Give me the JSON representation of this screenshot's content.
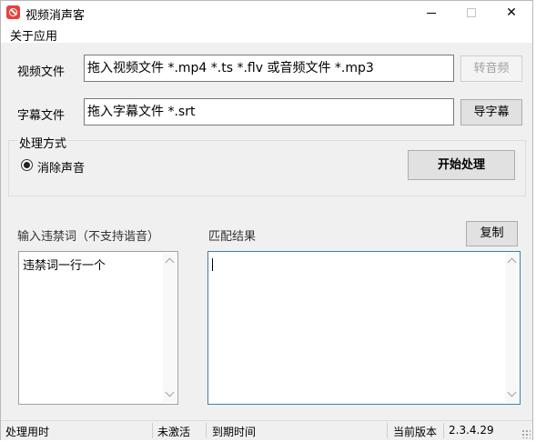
{
  "window": {
    "title": "视频消声客",
    "minimize_glyph": "—",
    "maximize_glyph": "☐",
    "close_glyph": "✕"
  },
  "menu": {
    "items": [
      "关于应用"
    ]
  },
  "video_row": {
    "label": "视频文件",
    "value": "拖入视频文件 *.mp4 *.ts *.flv 或音频文件 *.mp3",
    "button": "转音频"
  },
  "subtitle_row": {
    "label": "字幕文件",
    "value": "拖入字幕文件 *.srt",
    "button": "导字幕"
  },
  "processing": {
    "group_title": "处理方式",
    "option_label": "消除声音",
    "start_button": "开始处理"
  },
  "banned_words": {
    "label": "输入违禁词（不支持谐音）",
    "content": "违禁词一行一个"
  },
  "match_results": {
    "label": "匹配结果",
    "copy_button": "复制",
    "content": ""
  },
  "status": {
    "processing_time_label": "处理用时",
    "activation": "未激活",
    "expiry_label": "到期时间",
    "version_label": "当前版本",
    "version": "2.3.4.29"
  },
  "icons": {
    "app": "forbidden-icon",
    "minimize": "minimize-icon",
    "maximize": "maximize-icon",
    "close": "close-icon"
  }
}
